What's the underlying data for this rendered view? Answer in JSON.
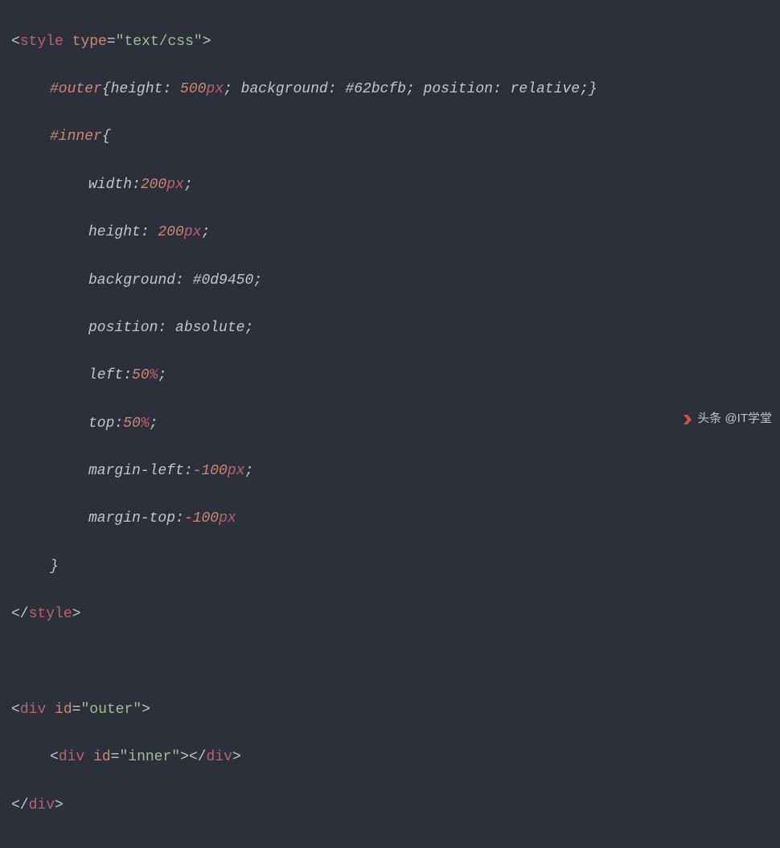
{
  "code": {
    "line1": {
      "open": "<",
      "tag": "style",
      "sp": " ",
      "attr": "type",
      "eq": "=",
      "q1": "\"",
      "val": "text/css",
      "q2": "\"",
      "close": ">"
    },
    "line2": {
      "sel": "#outer",
      "brace_open": "{",
      "p1": "height",
      "c1": ": ",
      "v1n": "500",
      "v1u": "px",
      "s1": "; ",
      "p2": "background",
      "c2": ": ",
      "v2": "#62bcfb",
      "s2": "; ",
      "p3": "position",
      "c3": ": ",
      "v3": "relative",
      "s3": ";",
      "brace_close": "}"
    },
    "line3": {
      "sel": "#inner",
      "brace_open": "{"
    },
    "line4": {
      "p": "width",
      "c": ":",
      "vn": "200",
      "vu": "px",
      "s": ";"
    },
    "line5": {
      "p": "height",
      "c": ": ",
      "vn": "200",
      "vu": "px",
      "s": ";"
    },
    "line6": {
      "p": "background",
      "c": ": ",
      "v": "#0d9450",
      "s": ";"
    },
    "line7": {
      "p": "position",
      "c": ": ",
      "v": "absolute",
      "s": ";"
    },
    "line8": {
      "p": "left",
      "c": ":",
      "vn": "50",
      "vu": "%",
      "s": ";"
    },
    "line9": {
      "p": "top",
      "c": ":",
      "vn": "50",
      "vu": "%",
      "s": ";"
    },
    "line10": {
      "p": "margin-left",
      "c": ":",
      "vn": "-100",
      "vu": "px",
      "s": ";"
    },
    "line11": {
      "p": "margin-top",
      "c": ":",
      "vn": "-100",
      "vu": "px"
    },
    "line12": {
      "brace_close": "}"
    },
    "line13": {
      "open": "</",
      "tag": "style",
      "close": ">"
    },
    "line14": "",
    "line15": {
      "open": "<",
      "tag": "div",
      "sp": " ",
      "attr": "id",
      "eq": "=",
      "q1": "\"",
      "val": "outer",
      "q2": "\"",
      "close": ">"
    },
    "line16": {
      "open1": "<",
      "tag1": "div",
      "sp": " ",
      "attr": "id",
      "eq": "=",
      "q1": "\"",
      "val": "inner",
      "q2": "\"",
      "close1": ">",
      "open2": "</",
      "tag2": "div",
      "close2": ">"
    },
    "line17": {
      "open": "</",
      "tag": "div",
      "close": ">"
    }
  },
  "watermark": {
    "text": "头条 @IT学堂"
  }
}
